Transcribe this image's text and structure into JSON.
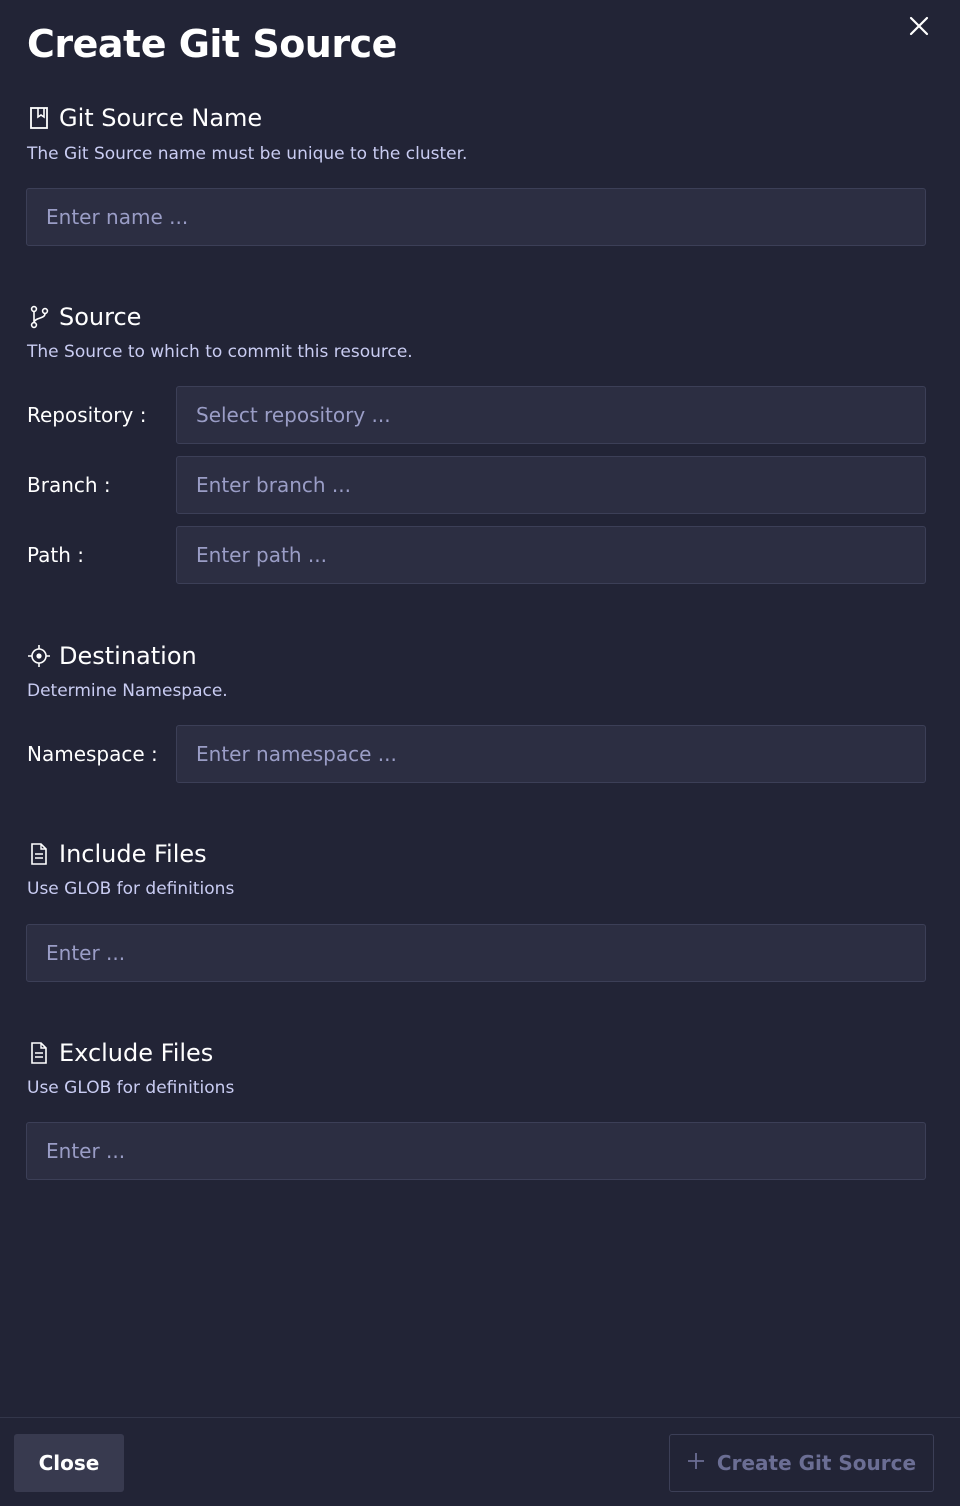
{
  "dialog": {
    "title": "Create Git Source"
  },
  "sections": {
    "name": {
      "icon": "bookmark-icon",
      "heading": "Git Source Name",
      "description": "The Git Source name must be unique to the cluster.",
      "placeholder": "Enter name ..."
    },
    "source": {
      "icon": "git-branch-icon",
      "heading": "Source",
      "description": "The Source to which to commit this resource.",
      "repository_label": "Repository",
      "repository_placeholder": "Select repository ...",
      "branch_label": "Branch",
      "branch_placeholder": "Enter branch ...",
      "path_label": "Path",
      "path_placeholder": "Enter path ..."
    },
    "destination": {
      "icon": "target-icon",
      "heading": "Destination",
      "description": "Determine Namespace.",
      "namespace_label": "Namespace",
      "namespace_placeholder": "Enter namespace ..."
    },
    "include": {
      "icon": "file-icon",
      "heading": "Include Files",
      "description": "Use GLOB for definitions",
      "placeholder": "Enter ..."
    },
    "exclude": {
      "icon": "file-icon",
      "heading": "Exclude Files",
      "description": "Use GLOB for definitions",
      "placeholder": "Enter ..."
    }
  },
  "footer": {
    "close_label": "Close",
    "create_label": "Create Git Source"
  },
  "colors": {
    "background": "#222436",
    "field_background": "#2c2e42",
    "description_text": "#c9ccf2",
    "placeholder_text": "#9a9dc6",
    "disabled_text": "#6b6e94"
  }
}
